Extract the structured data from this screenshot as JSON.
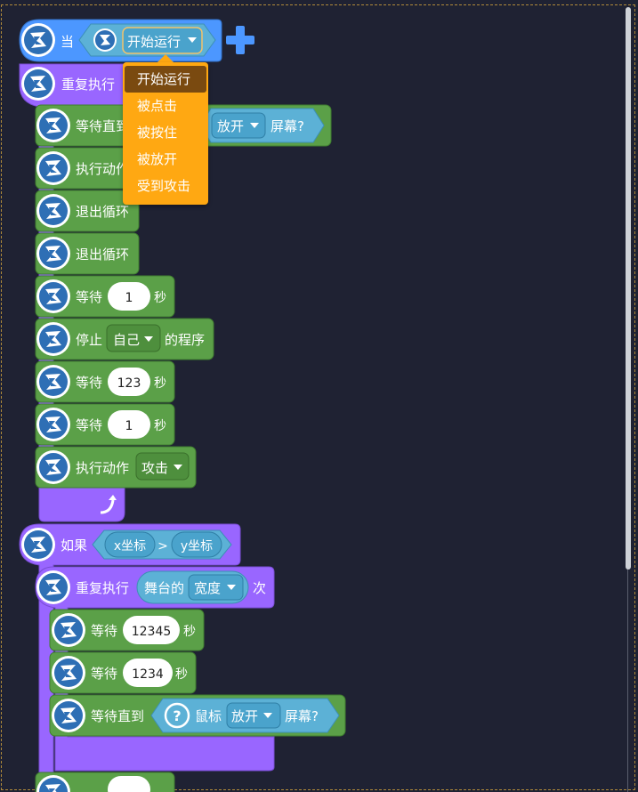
{
  "colors": {
    "background": "#1f2233",
    "event": "#4c97ff",
    "control": "#9966ff",
    "action": "#5ba048",
    "sensing": "#5cb1d6",
    "dropdown": "#ffa812"
  },
  "hat": {
    "when_label": "当",
    "event_value": "开始运行",
    "add_icon": "plus-icon"
  },
  "dropdown_menu": {
    "options": [
      "开始运行",
      "被点击",
      "被按住",
      "被放开",
      "受到攻击"
    ],
    "selected": "开始运行"
  },
  "loop1": {
    "label": "重复执行",
    "wait_until_label": "等待直到",
    "wait_until_option": "放开",
    "wait_until_suffix": "屏幕?",
    "do_action_label": "执行动作",
    "break_label_1": "退出循环",
    "break_label_2": "退出循环",
    "wait1_label": "等待",
    "wait1_value": "1",
    "wait1_unit": "秒",
    "stop_label": "停止",
    "stop_option": "自己",
    "stop_suffix": "的程序",
    "wait2_label": "等待",
    "wait2_value": "123",
    "wait2_unit": "秒",
    "wait3_label": "等待",
    "wait3_value": "1",
    "wait3_unit": "秒",
    "do_action2_label": "执行动作",
    "do_action2_option": "攻击",
    "loop_icon": "loop-arrow-icon"
  },
  "if_block": {
    "label": "如果",
    "left": "x坐标",
    "op": ">",
    "right": "y坐标"
  },
  "loop2": {
    "label": "重复执行",
    "reporter_label": "舞台的",
    "reporter_option": "宽度",
    "suffix": "次",
    "wait1_label": "等待",
    "wait1_value": "12345",
    "wait1_unit": "秒",
    "wait2_label": "等待",
    "wait2_value": "1234",
    "wait2_unit": "秒",
    "wait_until_label": "等待直到",
    "mouse_label": "鼠标",
    "mouse_option": "放开",
    "mouse_suffix": "屏幕?"
  }
}
